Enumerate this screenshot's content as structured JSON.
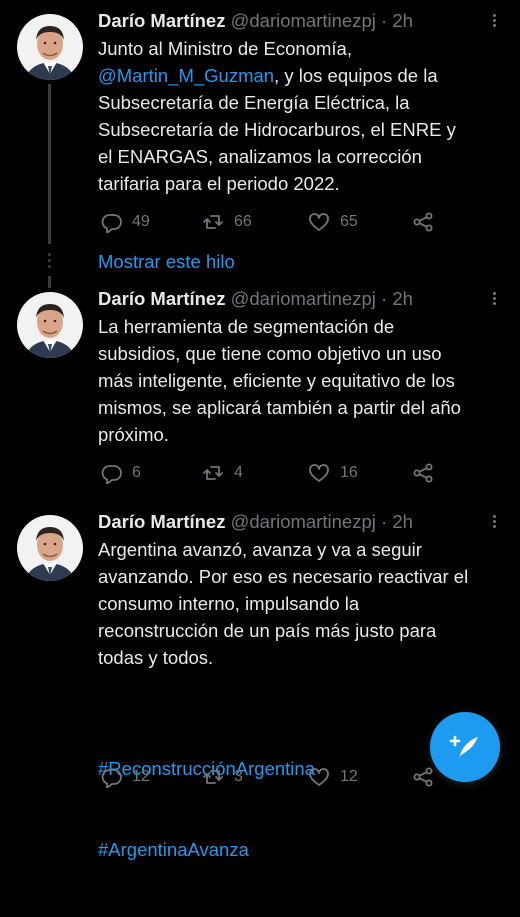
{
  "tweets": [
    {
      "name": "Darío Martínez",
      "handle": "@dariomartinezpj",
      "time": "· 2h",
      "text_parts": [
        "Junto al Ministro de Economía,\n",
        "@Martin_M_Guzman",
        ", y los equipos de la\nSubsecretaría de Energía Eléctrica, la\nSubsecretaría de Hidrocarburos, el ENRE y\nel ENARGAS, analizamos la corrección\ntarifaria para el periodo 2022."
      ],
      "replies": "49",
      "retweets": "66",
      "likes": "65"
    },
    {
      "name": "Darío Martínez",
      "handle": "@dariomartinezpj",
      "time": "· 2h",
      "text": "La herramienta de segmentación de\nsubsidios, que tiene como objetivo un uso\nmás inteligente, eficiente y equitativo de los\nmismos, se aplicará también a partir del año\npróximo.",
      "replies": "6",
      "retweets": "4",
      "likes": "16"
    },
    {
      "name": "Darío Martínez",
      "handle": "@dariomartinezpj",
      "time": "· 2h",
      "text": "Argentina avanzó, avanza y va a seguir\navanzando. Por eso es necesario reactivar el\nconsumo interno, impulsando la\nreconstrucción de un país más justo para\ntodas y todos.",
      "hashtags": [
        "#ReconstrucciónArgentina",
        "#ArgentinaAvanza"
      ],
      "replies": "12",
      "retweets": "3",
      "likes": "12"
    }
  ],
  "show_thread_label": "Mostrar este hilo",
  "icons": {
    "reply": "reply-icon",
    "retweet": "retweet-icon",
    "like": "heart-icon",
    "share": "share-icon",
    "compose": "compose-tweet-icon"
  },
  "colors": {
    "background": "#000000",
    "text": "#e7e9ea",
    "muted": "#71767b",
    "accent": "#1d9bf0"
  }
}
